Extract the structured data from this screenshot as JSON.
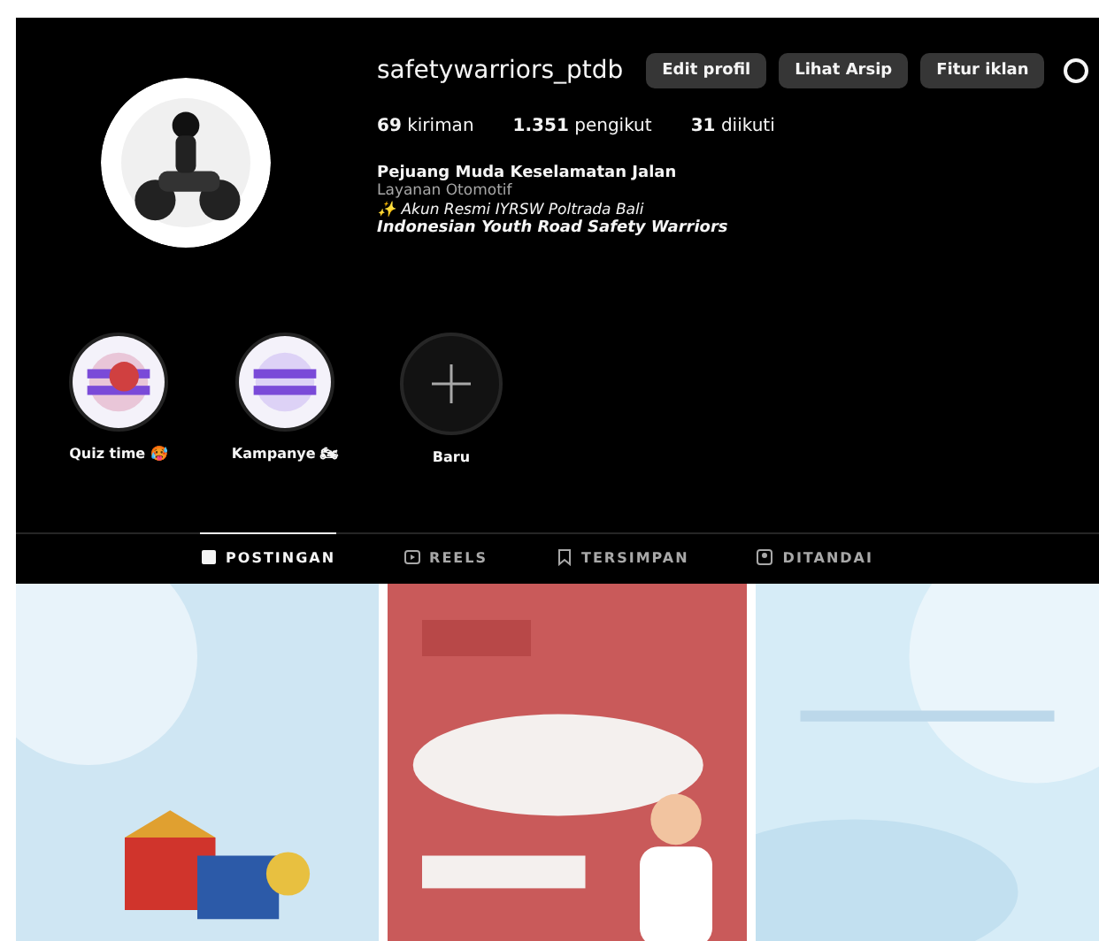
{
  "profile": {
    "username": "safetywarriors_ptdb",
    "buttons": [
      "Edit profil",
      "Lihat Arsip",
      "Fitur iklan"
    ],
    "stats": [
      {
        "count": "69",
        "label": "kiriman"
      },
      {
        "count": "1.351",
        "label": "pengikut"
      },
      {
        "count": "31",
        "label": "diikuti"
      }
    ],
    "name": "Pejuang Muda Keselamatan Jalan",
    "category": "Layanan Otomotif",
    "bio": [
      "✨ Akun Resmi IYRSW  Poltrada Bali"
    ],
    "tagline": "Indonesian Youth Road Safety Warriors"
  },
  "highlights": [
    {
      "kind": "story",
      "label": "Quiz time 🥵"
    },
    {
      "kind": "story",
      "label": "Kampanye 🏍"
    },
    {
      "kind": "new",
      "label": "Baru"
    }
  ],
  "tabs": [
    {
      "label": "POSTINGAN",
      "selected": true
    },
    {
      "label": "REELS",
      "selected": false
    },
    {
      "label": "TERSIMPAN",
      "selected": false
    },
    {
      "label": "DITANDAI",
      "selected": false
    }
  ]
}
